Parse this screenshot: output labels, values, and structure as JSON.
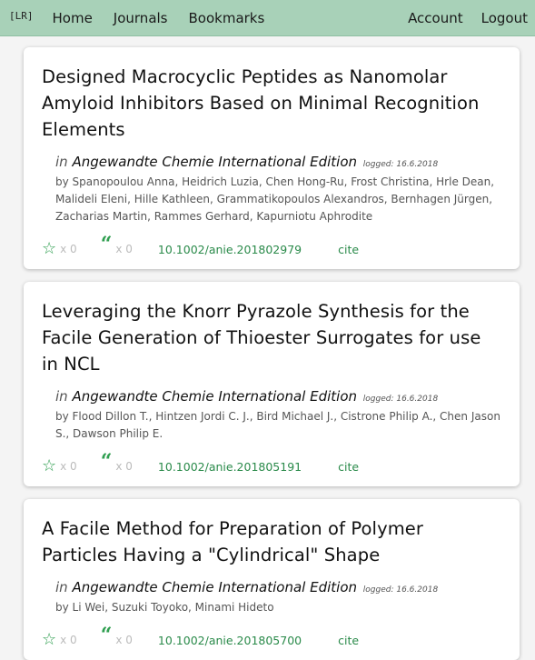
{
  "nav": {
    "brand": "[LR]",
    "home": "Home",
    "journals": "Journals",
    "bookmarks": "Bookmarks",
    "account": "Account",
    "logout": "Logout"
  },
  "articles": [
    {
      "title": "Designed Macrocyclic Peptides as Nanomolar Amyloid Inhibitors Based on Minimal Recognition Elements",
      "in": "in",
      "journal": "Angewandte Chemie International Edition",
      "logged": "logged: 16.6.2018",
      "authors": "by Spanopoulou Anna, Heidrich Luzia, Chen Hong-Ru, Frost Christina, Hrle Dean, Malideli Eleni, Hille Kathleen, Grammatikopoulos Alexandros, Bernhagen Jürgen, Zacharias Martin, Rammes Gerhard, Kapurniotu Aphrodite",
      "stars": "x 0",
      "quotes": "x 0",
      "doi": "10.1002/anie.201802979",
      "cite": "cite"
    },
    {
      "title": "Leveraging the Knorr Pyrazole Synthesis for the Facile Generation of Thioester Surrogates for use in NCL",
      "in": "in",
      "journal": "Angewandte Chemie International Edition",
      "logged": "logged: 16.6.2018",
      "authors": "by Flood Dillon T., Hintzen Jordi C. J., Bird Michael J., Cistrone Philip A., Chen Jason S., Dawson Philip E.",
      "stars": "x 0",
      "quotes": "x 0",
      "doi": "10.1002/anie.201805191",
      "cite": "cite"
    },
    {
      "title": "A Facile Method for Preparation of Polymer Particles Having a \"Cylindrical\" Shape",
      "in": "in",
      "journal": "Angewandte Chemie International Edition",
      "logged": "logged: 16.6.2018",
      "authors": "by Li Wei, Suzuki Toyoko, Minami Hideto",
      "stars": "x 0",
      "quotes": "x 0",
      "doi": "10.1002/anie.201805700",
      "cite": "cite"
    }
  ]
}
